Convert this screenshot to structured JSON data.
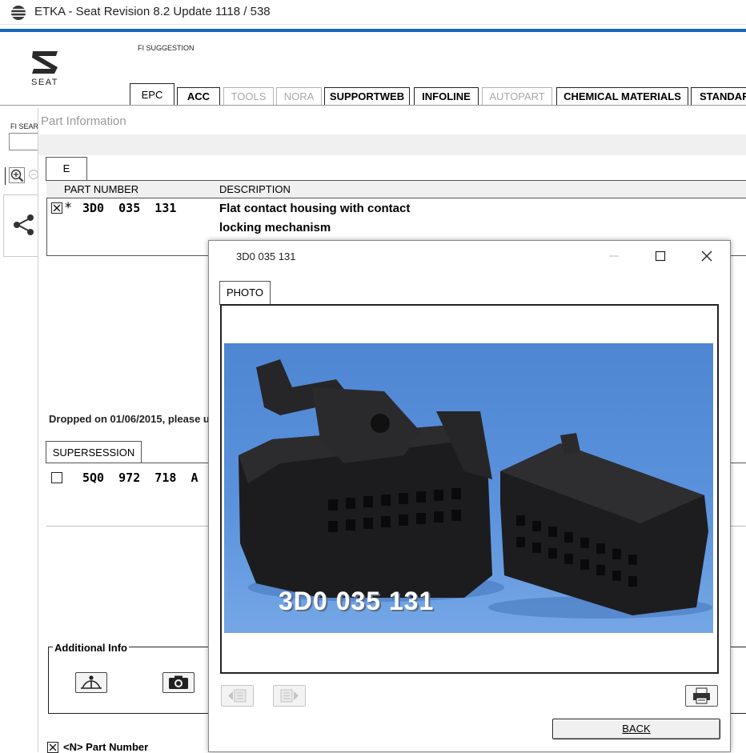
{
  "window": {
    "title": "ETKA - Seat Revision 8.2 Update 1118 / 538"
  },
  "brand": {
    "name": "SEAT",
    "accent_color": "#1a66b8"
  },
  "header": {
    "fi_suggestion": "FI SUGGESTION"
  },
  "tabs": [
    {
      "label": "EPC",
      "state": "active"
    },
    {
      "label": "ACC",
      "state": "enabled"
    },
    {
      "label": "TOOLS",
      "state": "disabled"
    },
    {
      "label": "NORA",
      "state": "disabled"
    },
    {
      "label": "SUPPORTWEB",
      "state": "enabled"
    },
    {
      "label": "INFOLINE",
      "state": "enabled"
    },
    {
      "label": "AUTOPART",
      "state": "disabled"
    },
    {
      "label": "CHEMICAL MATERIALS",
      "state": "enabled"
    },
    {
      "label": "STANDAR",
      "state": "enabled"
    }
  ],
  "left_pane": {
    "fi_search_label": "FI SEAR",
    "share_icon": "share-icon"
  },
  "part_info": {
    "title": "Part Information",
    "tab_label": "E",
    "columns": {
      "part_number": "PART NUMBER",
      "description": "DESCRIPTION"
    },
    "rows": [
      {
        "checked": true,
        "marker": "*",
        "part_number": "3D0  035  131",
        "description": "Flat contact housing with contact locking mechanism"
      }
    ],
    "dropped_notice": "Dropped on 01/06/2015, please u",
    "supersession": {
      "tab_label": "SUPERSESSION",
      "rows": [
        {
          "checked": false,
          "part_number": "5Q0  972  718  A"
        }
      ]
    },
    "additional_info": {
      "label": "Additional Info"
    },
    "footer": {
      "checked": true,
      "label": "<N> Part Number"
    }
  },
  "dialog": {
    "title": "3D0 035 131",
    "tab_label": "PHOTO",
    "photo_caption": "3D0 035 131",
    "back_label": "BACK",
    "icons": {
      "prev": "page-prev-icon",
      "next": "page-next-icon",
      "print": "printer-icon"
    }
  }
}
